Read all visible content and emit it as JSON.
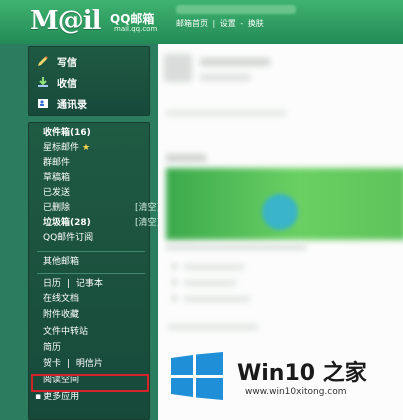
{
  "header": {
    "logo_text": "M@il",
    "logo_cn": "QQ邮箱",
    "logo_sub": "mail.qq.com",
    "links": [
      "邮箱首页",
      "|",
      "设置",
      "-",
      "换肤"
    ]
  },
  "sidebar": {
    "actions": [
      {
        "label": "写信",
        "icon": "pencil-icon"
      },
      {
        "label": "收信",
        "icon": "download-icon"
      },
      {
        "label": "通讯录",
        "icon": "contacts-icon"
      }
    ],
    "folders": {
      "inbox": "收件箱(16)",
      "starred": "星标邮件",
      "group": "群邮件",
      "drafts": "草稿箱",
      "sent": "已发送",
      "deleted": "已删除",
      "deleted_clear": "[清空]",
      "spam": "垃圾箱(28)",
      "spam_clear": "[清空]",
      "subscription": "QQ邮件订阅"
    },
    "other_mailbox": "其他邮箱",
    "tools": {
      "calendar": "日历",
      "sep": "|",
      "notes": "记事本",
      "docs": "在线文档",
      "attachments": "附件收藏",
      "transfer": "文件中转站",
      "resume": "简历",
      "cards": "贺卡",
      "postcards": "明信片",
      "reading": "阅读空间",
      "more": "更多应用"
    }
  },
  "watermark": {
    "title": "Win10 之家",
    "url": "www.win10xitong.com",
    "colors": {
      "logo": "#1f8fd8"
    }
  },
  "colors": {
    "header": "#2e9c63",
    "sidebar": "#2c7d5f",
    "panel": "#1d5541",
    "highlight": "#d3242a"
  }
}
